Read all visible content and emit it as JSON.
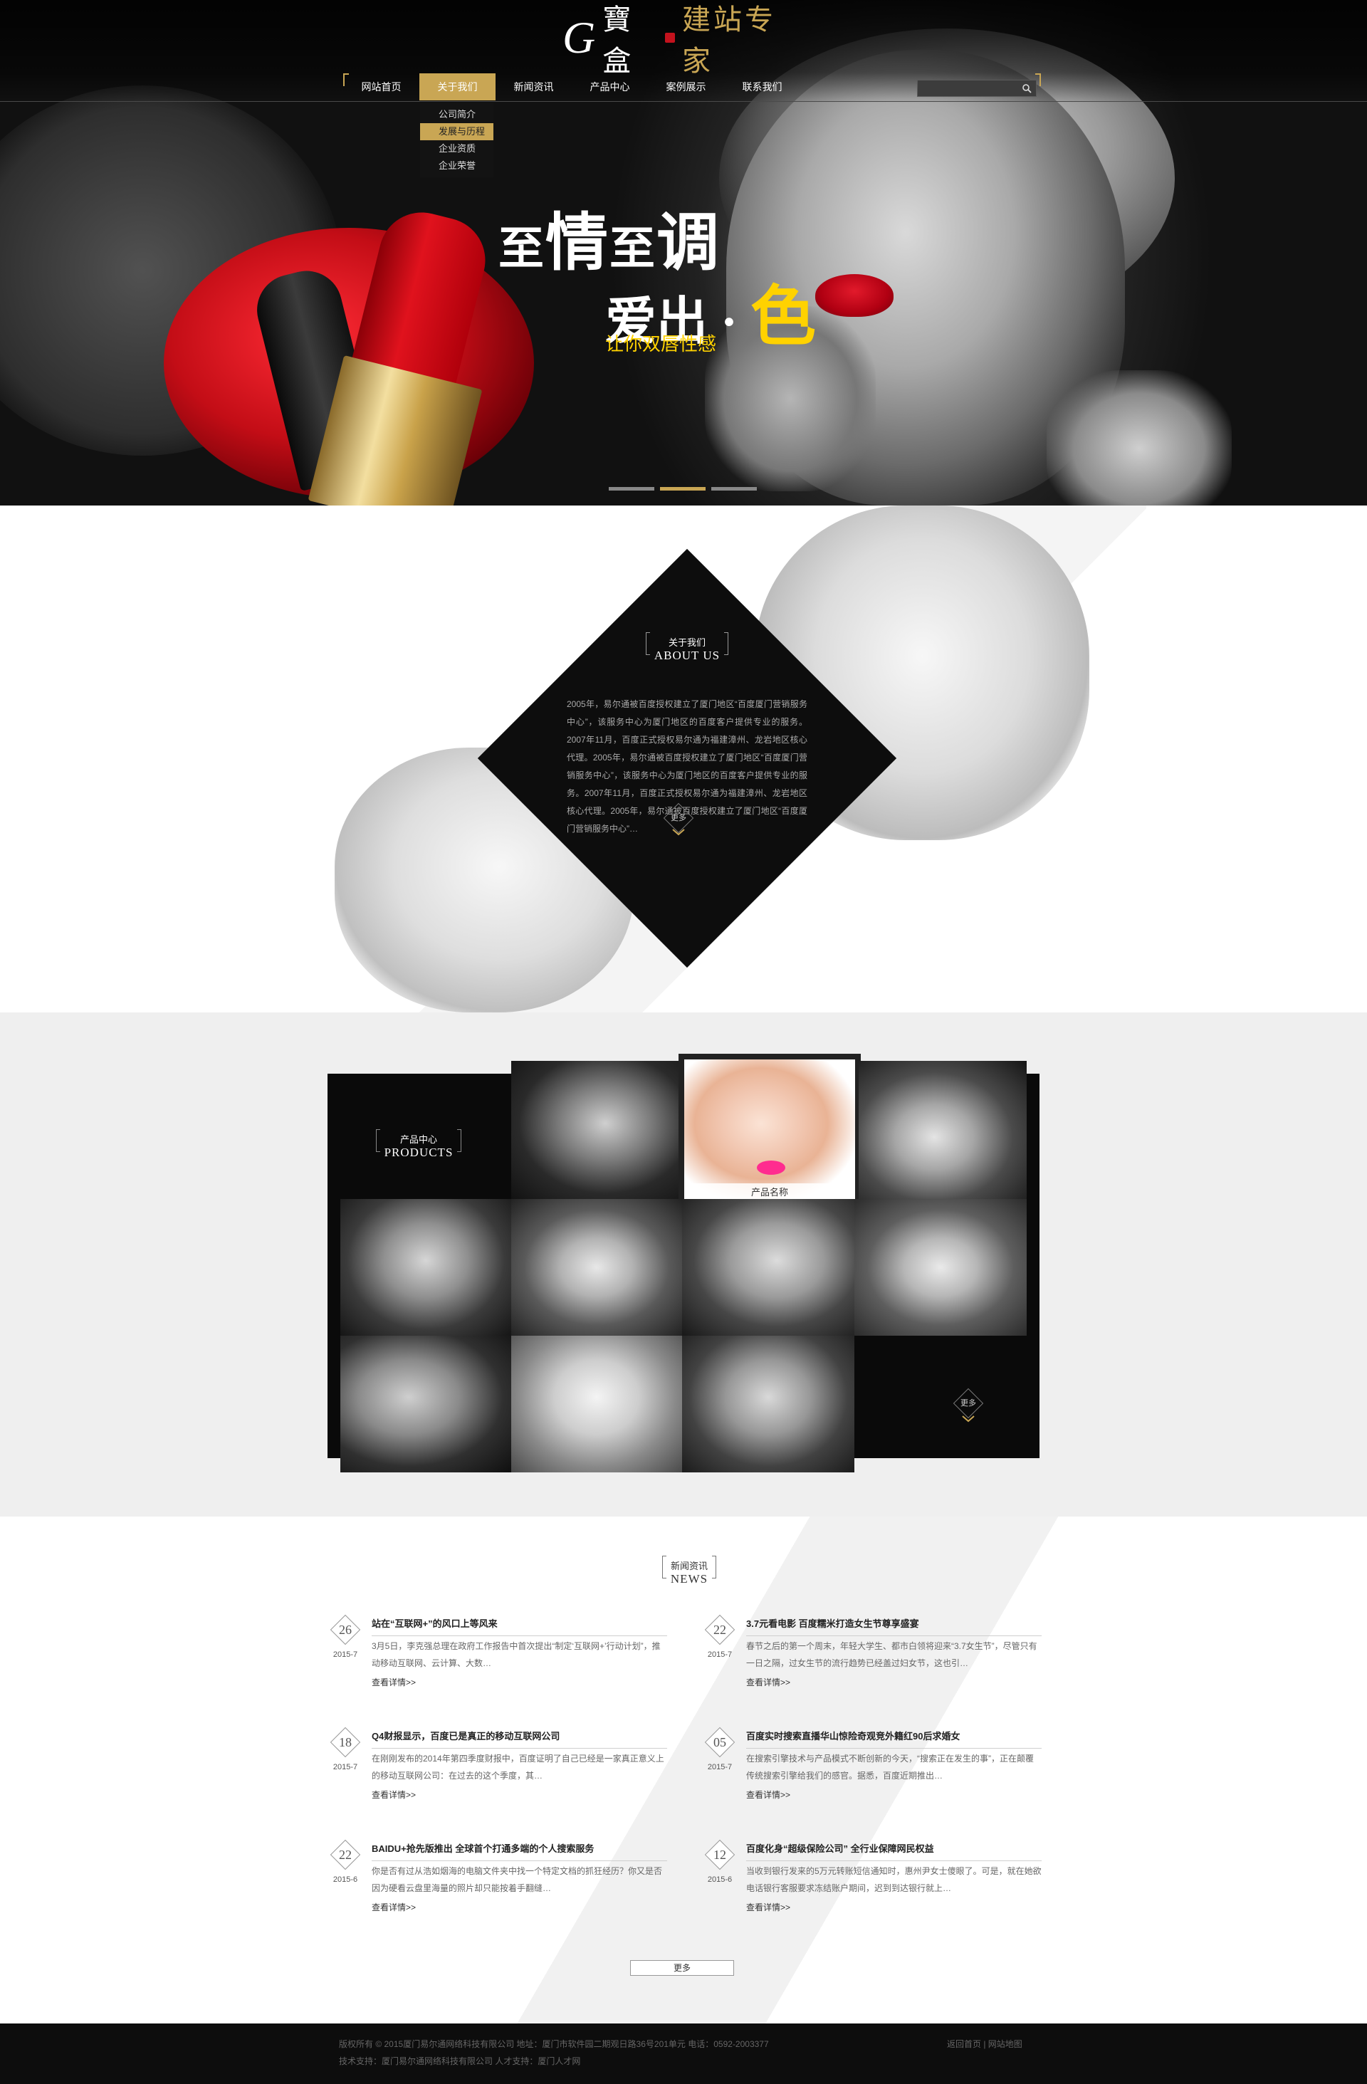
{
  "logo": {
    "letter": "G",
    "brand": "寶盒",
    "slogan": "建站专家"
  },
  "nav": {
    "items": [
      "网站首页",
      "关于我们",
      "新闻资讯",
      "产品中心",
      "案例展示",
      "联系我们"
    ],
    "active_index": 1,
    "submenu": [
      "公司简介",
      "发展与历程",
      "企业资质",
      "企业荣誉"
    ],
    "submenu_highlight_index": 1
  },
  "search": {
    "placeholder": "",
    "icon": "search-icon"
  },
  "hero": {
    "line1_a": "至",
    "line1_b": "情",
    "line1_c": "至",
    "line1_d": "调",
    "line2_a": "爱出 · ",
    "line2_b": "色",
    "line3": "让你双唇性感",
    "slides": 3,
    "active_slide": 1
  },
  "about": {
    "title_cn": "关于我们",
    "title_en": "ABOUT US",
    "desc": "2005年，易尔通被百度授权建立了厦门地区“百度厦门营销服务中心”，该服务中心为厦门地区的百度客户提供专业的服务。2007年11月，百度正式授权易尔通为福建漳州、龙岩地区核心代理。2005年，易尔通被百度授权建立了厦门地区“百度厦门营销服务中心”，该服务中心为厦门地区的百度客户提供专业的服务。2007年11月，百度正式授权易尔通为福建漳州、龙岩地区核心代理。2005年，易尔通被百度授权建立了厦门地区“百度厦门营销服务中心”…",
    "more": "更多"
  },
  "products": {
    "title_cn": "产品中心",
    "title_en": "PRODUCTS",
    "featured_label": "产品名称",
    "more": "更多"
  },
  "news": {
    "title_cn": "新闻资讯",
    "title_en": "NEWS",
    "items": [
      {
        "day": "26",
        "ym": "2015-7",
        "title": "站在“互联网+”的风口上等风来",
        "body": "3月5日，李克强总理在政府工作报告中首次提出“制定‘互联网+’行动计划”，推动移动互联网、云计算、大数…",
        "link": "查看详情>>"
      },
      {
        "day": "22",
        "ym": "2015-7",
        "title": "3.7元看电影 百度糯米打造女生节尊享盛宴",
        "body": "春节之后的第一个周末，年轻大学生、都市白领将迎来“3.7女生节”，尽管只有一日之隔，过女生节的流行趋势已经盖过妇女节，这也引…",
        "link": "查看详情>>"
      },
      {
        "day": "18",
        "ym": "2015-7",
        "title": "Q4财报显示，百度已是真正的移动互联网公司",
        "body": "在刚刚发布的2014年第四季度财报中，百度证明了自己已经是一家真正意义上的移动互联网公司：在过去的这个季度，其…",
        "link": "查看详情>>"
      },
      {
        "day": "05",
        "ym": "2015-7",
        "title": "百度实时搜索直播华山惊险奇观竞外籍红90后求婚女",
        "body": "在搜索引擎技术与产品模式不断创新的今天，“搜索正在发生的事”，正在颠覆传统搜索引擎给我们的感官。据悉，百度近期推出…",
        "link": "查看详情>>"
      },
      {
        "day": "22",
        "ym": "2015-6",
        "title": "BAIDU+抢先版推出 全球首个打通多端的个人搜索服务",
        "body": "你是否有过从浩如烟海的电脑文件夹中找一个特定文档的抓狂经历？你又是否因为硬看云盘里海量的照片却只能按着手翻缝…",
        "link": "查看详情>>"
      },
      {
        "day": "12",
        "ym": "2015-6",
        "title": "百度化身“超级保险公司” 全行业保障网民权益",
        "body": "当收到银行发来的5万元转账短信通知时，惠州尹女士傻眼了。可是，就在她欲电话银行客服要求冻结账户期间，迟到到达银行就上…",
        "link": "查看详情>>"
      }
    ],
    "more": "更多"
  },
  "footer": {
    "line1": "版权所有 © 2015厦门易尔通网络科技有限公司   地址：厦门市软件园二期观日路36号201单元  电话：0592-2003377",
    "line2": "技术支持：厦门易尔通网络科技有限公司   人才支持：厦门人才网",
    "links": "返回首页  |  网站地图"
  },
  "colors": {
    "accent": "#c9a654",
    "hero_yellow": "#ffd200",
    "dark": "#0d0d0d",
    "lips": "#d0101c"
  }
}
